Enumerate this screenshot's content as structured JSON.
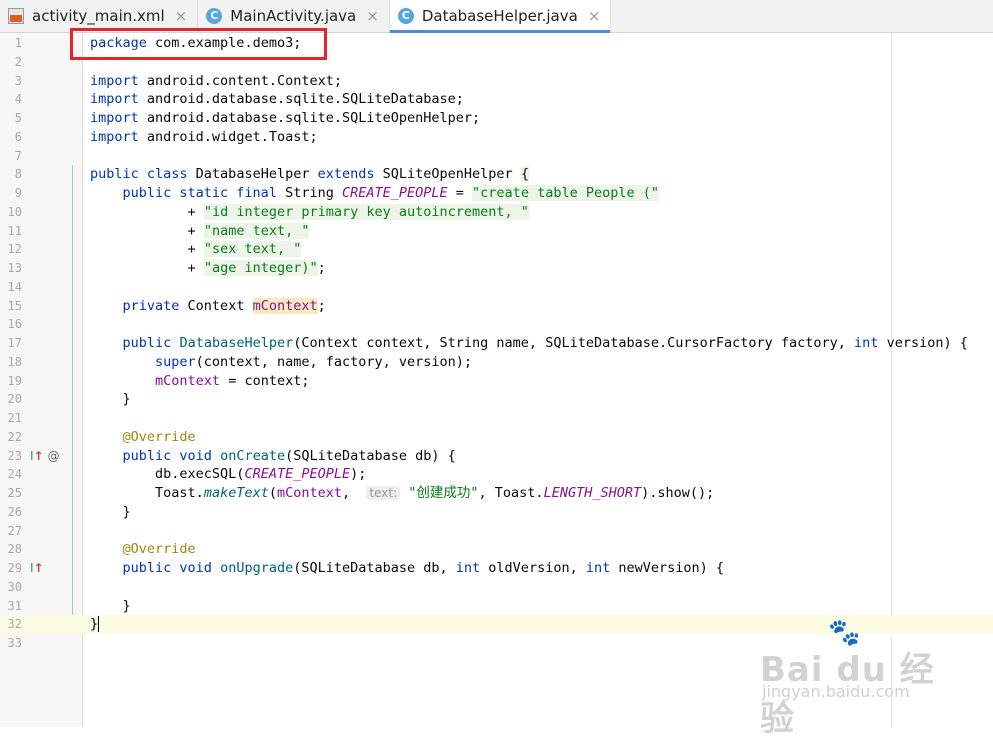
{
  "tabs": [
    {
      "label": "activity_main.xml",
      "icon": "xml-file-icon",
      "active": false
    },
    {
      "label": "MainActivity.java",
      "icon": "java-class-icon",
      "active": false
    },
    {
      "label": "DatabaseHelper.java",
      "icon": "java-class-icon",
      "active": true
    }
  ],
  "tab_close_glyph": "×",
  "line_numbers": [
    "1",
    "2",
    "3",
    "4",
    "5",
    "6",
    "7",
    "8",
    "9",
    "10",
    "11",
    "12",
    "13",
    "14",
    "15",
    "16",
    "17",
    "18",
    "19",
    "20",
    "21",
    "22",
    "23",
    "24",
    "25",
    "26",
    "27",
    "28",
    "29",
    "30",
    "31",
    "32",
    "33"
  ],
  "code": {
    "l1": {
      "kw": "package",
      "rest": " com.example.demo3;"
    },
    "l3": {
      "kw": "import",
      "rest": " android.content.Context;"
    },
    "l4": {
      "kw": "import",
      "rest": " android.database.sqlite.SQLiteDatabase;"
    },
    "l5": {
      "kw": "import",
      "rest": " android.database.sqlite.SQLiteOpenHelper;"
    },
    "l6": {
      "kw": "import",
      "rest": " android.widget.Toast;"
    },
    "l8": {
      "kw1": "public class",
      "name": " DatabaseHelper ",
      "kw2": "extends",
      "rest": " SQLiteOpenHelper ",
      "brace": "{"
    },
    "l9": {
      "indent": "    ",
      "kw": "public static final",
      "type": " String ",
      "const": "CREATE_PEOPLE",
      "eq": " = ",
      "str": "\"create table People (\""
    },
    "l10": {
      "indent": "            ",
      "op": "+ ",
      "str": "\"id integer primary key autoincrement, \""
    },
    "l11": {
      "indent": "            ",
      "op": "+ ",
      "str": "\"name text, \""
    },
    "l12": {
      "indent": "            ",
      "op": "+ ",
      "str": "\"sex text, \""
    },
    "l13": {
      "indent": "            ",
      "op": "+ ",
      "str": "\"age integer)\"",
      "end": ";"
    },
    "l15": {
      "indent": "    ",
      "kw": "private",
      "type": " Context ",
      "field": "mContext",
      "end": ";"
    },
    "l17": {
      "indent": "    ",
      "kw": "public",
      "sp": " ",
      "method": "DatabaseHelper",
      "p1": "(Context context, String name, SQLiteDatabase.CursorFactory factory, ",
      "kw2": "int",
      "p2": " version) {"
    },
    "l18": {
      "indent": "        ",
      "kw": "super",
      "rest": "(context, name, factory, version);"
    },
    "l19": {
      "indent": "        ",
      "field": "mContext",
      "rest": " = context;"
    },
    "l20": {
      "text": "    }"
    },
    "l22": {
      "indent": "    ",
      "ann": "@Override"
    },
    "l23": {
      "indent": "    ",
      "kw": "public void",
      "sp": " ",
      "method": "onCreate",
      "rest": "(SQLiteDatabase db) {"
    },
    "l24": {
      "indent": "        ",
      "pre": "db.execSQL(",
      "const": "CREATE_PEOPLE",
      "end": ");"
    },
    "l25": {
      "indent": "        ",
      "pre": "Toast.",
      "method": "makeText",
      "p1": "(",
      "field": "mContext",
      "comma": ",  ",
      "hint": "text:",
      "str": " \"创建成功\"",
      "p2": ", Toast.",
      "const": "LENGTH_SHORT",
      "end": ").show();"
    },
    "l26": {
      "text": "    }"
    },
    "l28": {
      "indent": "    ",
      "ann": "@Override"
    },
    "l29": {
      "indent": "    ",
      "kw": "public void",
      "sp": " ",
      "method": "onUpgrade",
      "p1": "(SQLiteDatabase db, ",
      "kw2": "int",
      "p2": " oldVersion, ",
      "kw3": "int",
      "p3": " newVersion) {"
    },
    "l31": {
      "text": "    }"
    },
    "l32": {
      "brace": "}"
    }
  },
  "gutter_icons": {
    "implement_glyph": "I",
    "arrow_glyph": "↑",
    "override_glyph": "@"
  },
  "watermark": {
    "brand": "Bai du 经验",
    "url": "jingyan.baidu.com"
  },
  "colors": {
    "keyword": "#0033b3",
    "string": "#067d17",
    "constant": "#871094",
    "annotation": "#9e880d",
    "highlight_box": "#e8232a",
    "active_tab_underline": "#4a89dc"
  }
}
